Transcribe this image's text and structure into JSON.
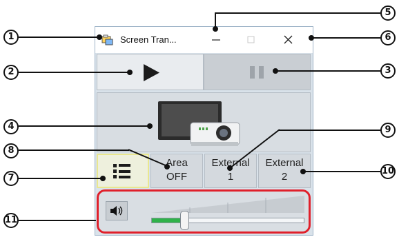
{
  "window": {
    "title": "Screen Tran...",
    "titlebar_buttons": [
      "minimize",
      "maximize",
      "close"
    ]
  },
  "controls": {
    "play_icon": "play-icon",
    "pause_icon": "pause-icon",
    "display_icon": "monitor-projector-icon",
    "list_icon": "list-icon",
    "area": {
      "line1": "Area",
      "line2": "OFF"
    },
    "external1": {
      "line1": "External",
      "line2": "1"
    },
    "external2": {
      "line1": "External",
      "line2": "2"
    }
  },
  "volume": {
    "icon": "speaker-icon",
    "level": 0.2
  },
  "callouts": [
    {
      "label": "1"
    },
    {
      "label": "2"
    },
    {
      "label": "3"
    },
    {
      "label": "4"
    },
    {
      "label": "5"
    },
    {
      "label": "6"
    },
    {
      "label": "7"
    },
    {
      "label": "8"
    },
    {
      "label": "9"
    },
    {
      "label": "10"
    },
    {
      "label": "11"
    }
  ],
  "colors": {
    "highlight": "#e0202b",
    "volume_fill": "#2fb24a",
    "list_button_border": "#e9e78f"
  }
}
